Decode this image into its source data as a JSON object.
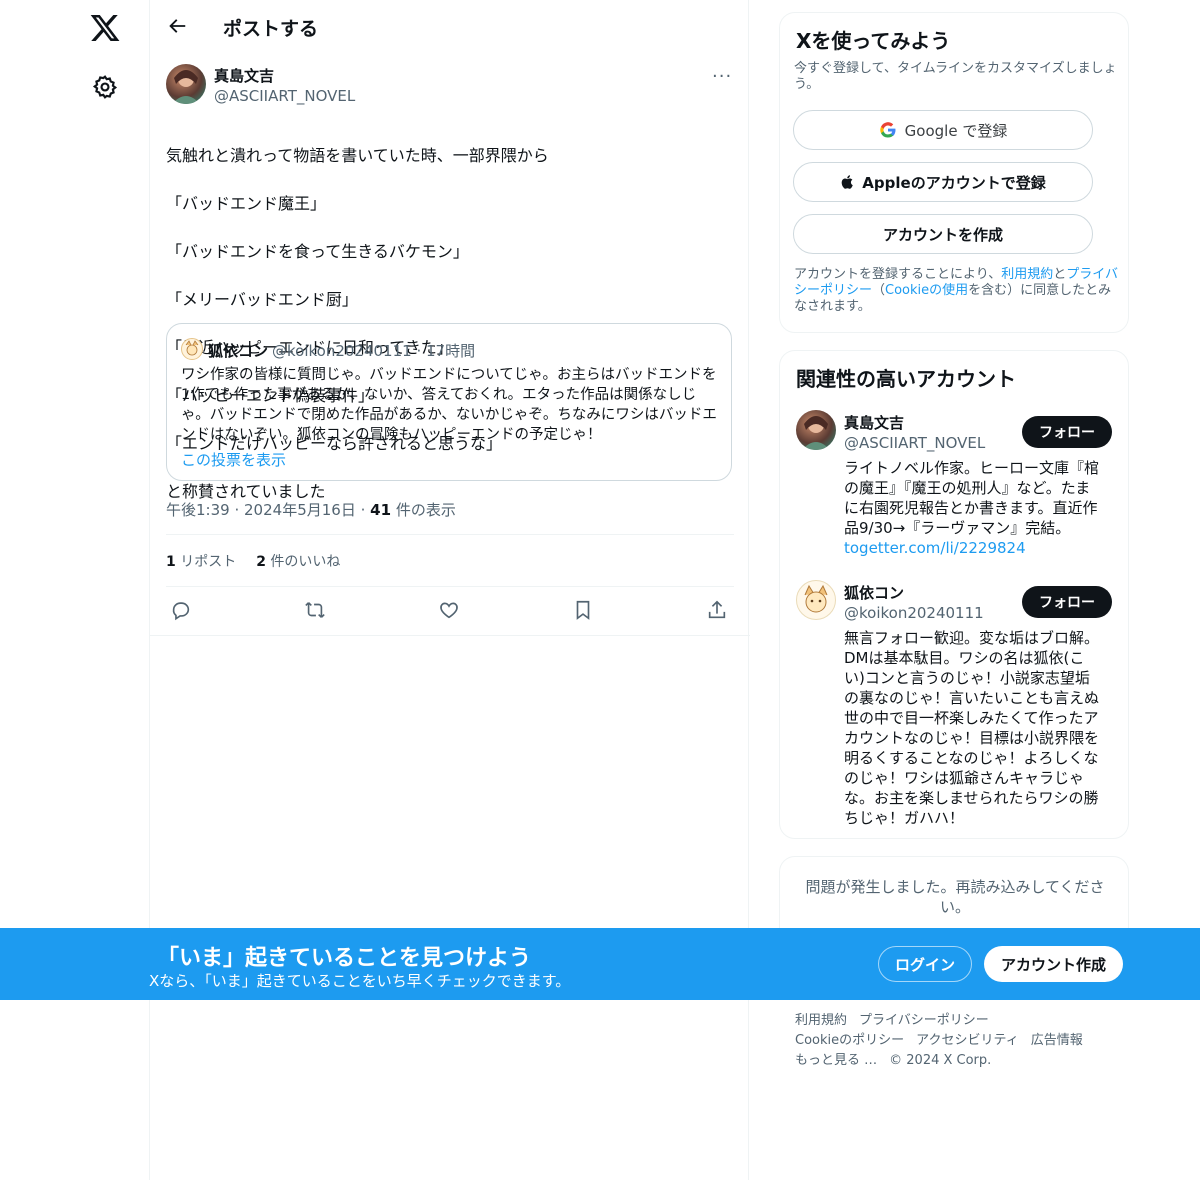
{
  "nav": {
    "logo_icon": "x-logo-icon",
    "settings_icon": "gear-icon"
  },
  "header": {
    "title": "ポストする",
    "back_icon": "arrow-left-icon"
  },
  "post": {
    "author_name": "真島文吉",
    "author_handle": "@ASCIIART_NOVEL",
    "more_label": "···",
    "lines": [
      "気触れと潰れって物語を書いていた時、一部界隈から",
      "「バッドエンド魔王」",
      "「バッドエンドを食って生きるバケモン」",
      "「メリーバッドエンド厨」",
      "「最近ハッピーエンドに日和ってきた」",
      "「ハッピーエンド偽装事件」",
      "「エンドだけハッピーなら許されると思うな」",
      "と称賛されていました"
    ],
    "quote": {
      "author_name": "狐依コン",
      "meta": "@koikon20240111 · 17時間",
      "text": "ワシ作家の皆様に質問じゃ。バッドエンドについてじゃ。お主らはバッドエンドを1作でも作った事があるか、ないか、答えておくれ。エタった作品は関係なしじゃ。バッドエンドで閉めた作品があるか、ないかじゃぞ。ちなみにワシはバッドエンドはないぞい。狐依コンの冒険もハッピーエンドの予定じゃ！",
      "link": "この投票を表示"
    },
    "time": "午後1:39",
    "date": "2024年5月16日",
    "views_count": "41",
    "views_label": "件の表示",
    "reposts_count": "1",
    "reposts_label": "リポスト",
    "likes_count": "2",
    "likes_label": "件のいいね"
  },
  "signup_card": {
    "title": "Xを使ってみよう",
    "subtitle": "今すぐ登録して、タイムラインをカスタマイズしましょう。",
    "google_label": "Google で登録",
    "apple_label": "Appleのアカウントで登録",
    "create_label": "アカウントを作成",
    "legal_prefix": "アカウントを登録することにより、",
    "terms_link": "利用規約",
    "legal_and": "と",
    "privacy_link": "プライバシーポリシー",
    "legal_paren_open": "（",
    "cookie_link": "Cookieの使用",
    "legal_suffix": "を含む）に同意したとみなされます。"
  },
  "related": {
    "title": "関連性の高いアカウント",
    "follow_label": "フォロー",
    "accounts": [
      {
        "name": "真島文吉",
        "handle": "@ASCIIART_NOVEL",
        "bio": "ライトノベル作家。ヒーロー文庫『棺の魔王』『魔王の処刑人』など。たまに右園死児報告とか書きます。直近作品9/30→『ラーヴァマン』完結。",
        "link": "togetter.com/li/2229824"
      },
      {
        "name": "狐依コン",
        "handle": "@koikon20240111",
        "bio": "無言フォロー歓迎。変な垢はブロ解。DMは基本駄目。ワシの名は狐依(こい)コンと言うのじゃ！小説家志望垢の裏なのじゃ！言いたいことも言えぬ世の中で目一杯楽しみたくて作ったアカウントなのじゃ！目標は小説界隈を明るくすることなのじゃ！よろしくなのじゃ！ワシは狐爺さんキャラじゃな。お主を楽しませられたらワシの勝ちじゃ！ガハハ！",
        "link": ""
      }
    ]
  },
  "error_card": {
    "text": "問題が発生しました。再読み込みしてください。"
  },
  "footer": {
    "links": [
      "利用規約",
      "プライバシーポリシー",
      "Cookieのポリシー",
      "アクセシビリティ",
      "広告情報",
      "もっと見る …"
    ],
    "copyright": "© 2024 X Corp."
  },
  "banner": {
    "title": "「いま」起きていることを見つけよう",
    "subtitle": "Xなら、「いま」起きていることをいち早くチェックできます。",
    "login_label": "ログイン",
    "signup_label": "アカウント作成"
  },
  "colors": {
    "accent": "#1d9bf0",
    "text": "#0f1419",
    "muted": "#536471",
    "border": "#eff3f4"
  }
}
